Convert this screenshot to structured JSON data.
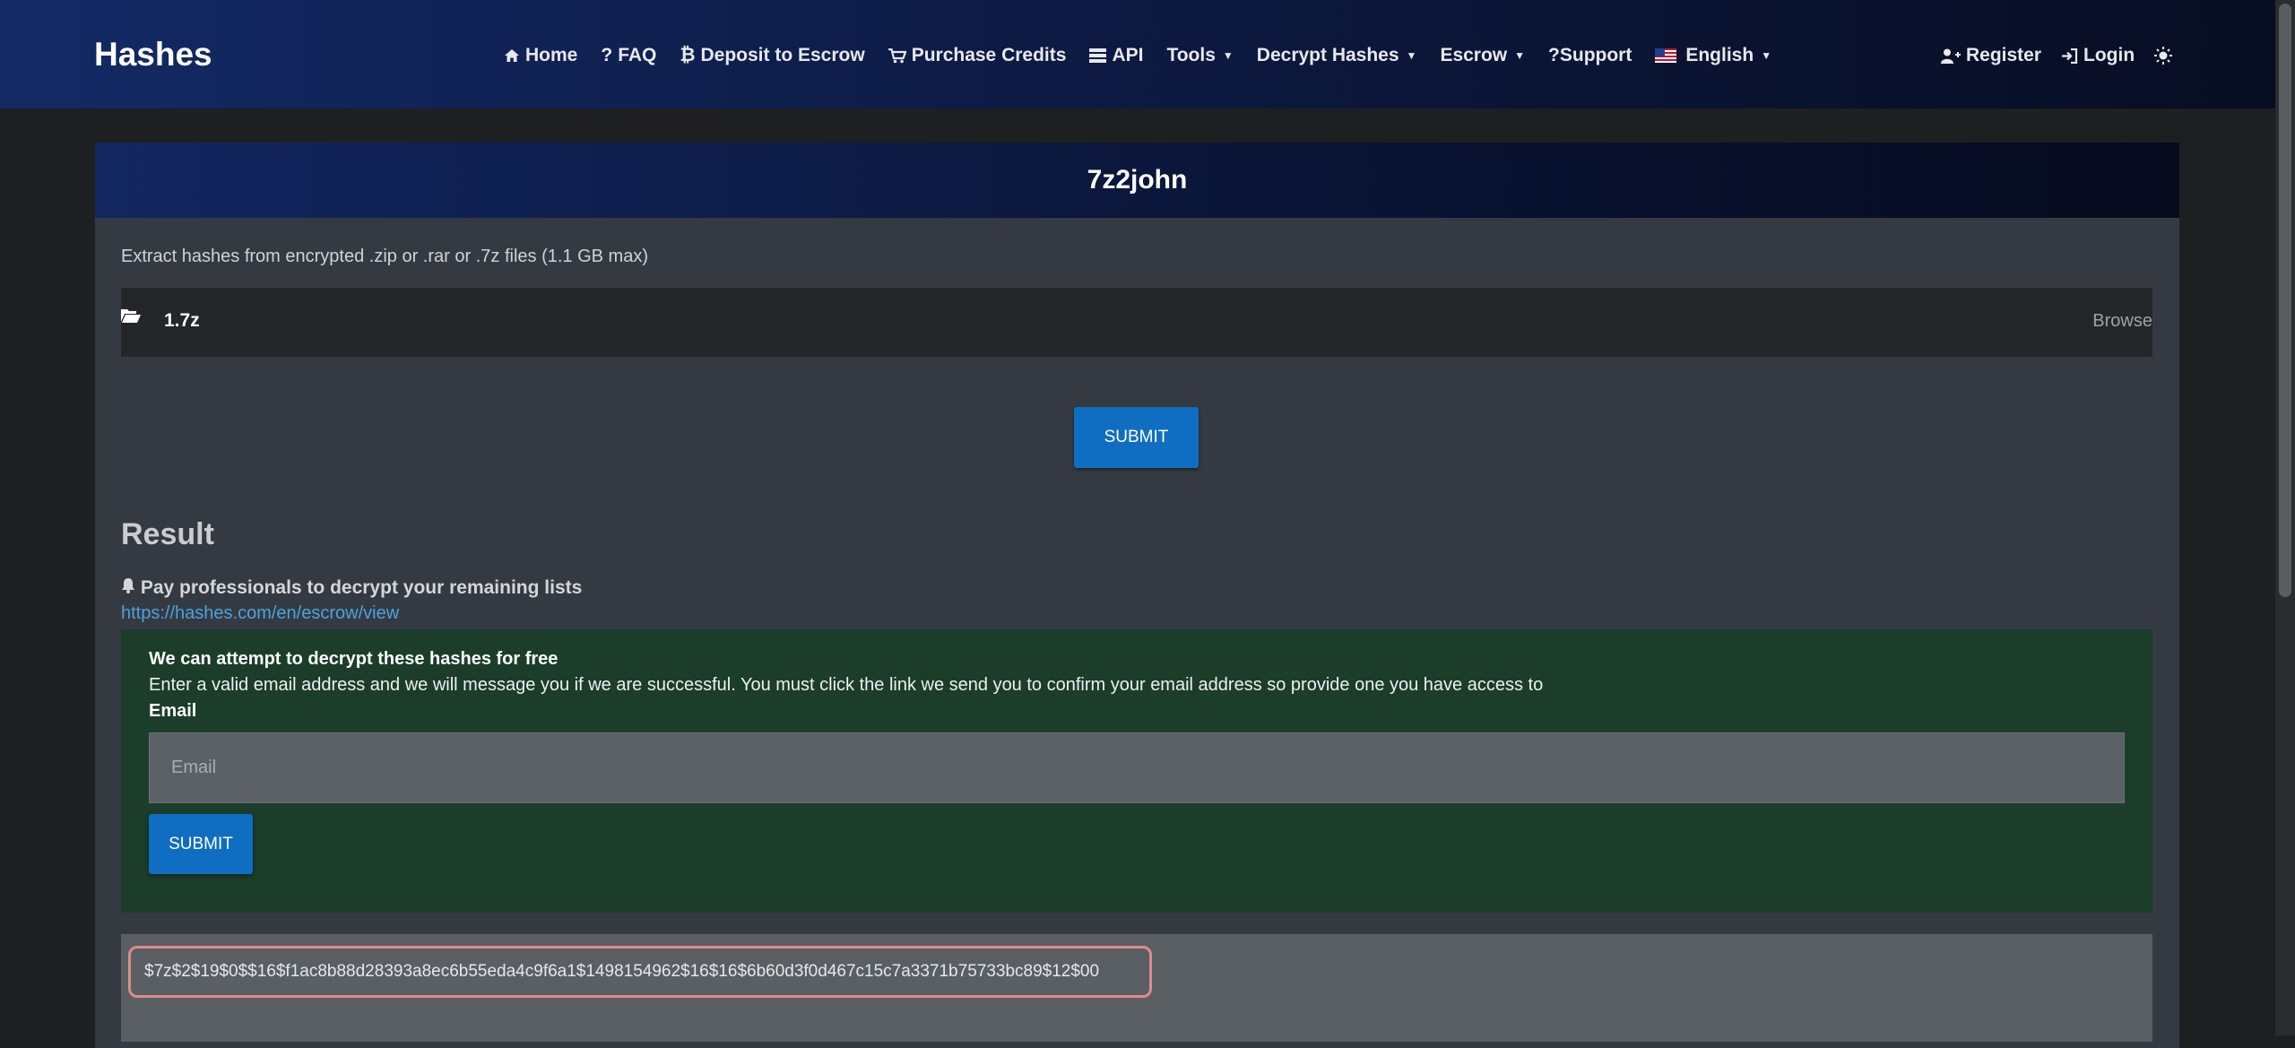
{
  "brand": "Hashes",
  "nav": {
    "home": "Home",
    "faq": "FAQ",
    "deposit": "Deposit to Escrow",
    "purchase": "Purchase Credits",
    "api": "API",
    "tools": "Tools",
    "decrypt": "Decrypt Hashes",
    "escrow": "Escrow",
    "support": "?Support",
    "language": "English",
    "register": "Register",
    "login": "Login"
  },
  "card": {
    "title": "7z2john",
    "description": "Extract hashes from encrypted .zip or .rar or .7z files (1.1 GB max)",
    "file_name": "1.7z",
    "browse_label": "Browse",
    "submit_label": "SUBMIT"
  },
  "result": {
    "title": "Result",
    "notice": "Pay professionals to decrypt your remaining lists",
    "link": "https://hashes.com/en/escrow/view",
    "free": {
      "title": "We can attempt to decrypt these hashes for free",
      "text": "Enter a valid email address and we will message you if we are successful. You must click the link we send you to confirm your email address so provide one you have access to",
      "email_label": "Email",
      "email_placeholder": "Email",
      "email_value": "",
      "submit_label": "SUBMIT"
    },
    "hash": "$7z$2$19$0$$16$f1ac8b88d28393a8ec6b55eda4c9f6a1$1498154962$16$16$6b60d3f0d467c15c7a3371b75733bc89$12$00"
  },
  "colors": {
    "accent": "#0f6ec2",
    "link": "#4aa3df",
    "success_bg": "#1b3d2a",
    "highlight_border": "#e08a8e"
  },
  "icons": [
    "home-icon",
    "question-icon",
    "bitcoin-icon",
    "cart-icon",
    "api-icon",
    "user-plus-icon",
    "sign-in-icon",
    "theme-toggle-icon",
    "folder-open-icon",
    "bell-icon"
  ]
}
